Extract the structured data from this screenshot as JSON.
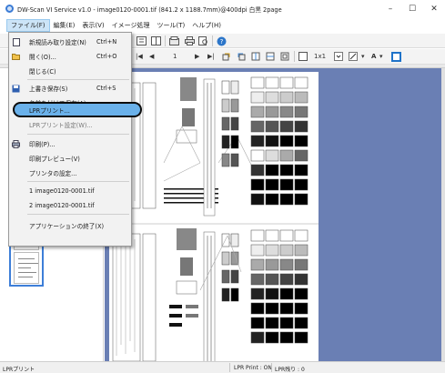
{
  "window": {
    "title": "DW-Scan VI Service v1.0 - image0120-0001.tif (841.2 x 1188.7mm)@400dpi 白黒 2page",
    "minimize": "–",
    "maximize": "☐",
    "close": "✕"
  },
  "menubar": {
    "items": [
      "ファイル(F)",
      "編集(E)",
      "表示(V)",
      "イメージ処理",
      "ツール(T)",
      "ヘルプ(H)"
    ]
  },
  "toolbar": {
    "page_number": "1",
    "zoom_label": "1x1",
    "font_label": "A"
  },
  "document_tab": {
    "label": "00dpi 白黒 2page",
    "close": "×"
  },
  "file_menu": {
    "items": [
      {
        "label": "新規読み取り設定(N)",
        "shortcut": "Ctrl+N",
        "icon": "page-icon"
      },
      {
        "label": "開く(O)...",
        "shortcut": "Ctrl+O",
        "icon": "folder-icon"
      },
      {
        "label": "閉じる(C)",
        "shortcut": "",
        "icon": ""
      },
      {
        "label": "上書き保存(S)",
        "shortcut": "Ctrl+S",
        "icon": "save-icon"
      },
      {
        "label": "名前を付けて保存(A)...",
        "shortcut": "",
        "icon": ""
      },
      {
        "label": "LPRプリント...",
        "shortcut": "",
        "icon": ""
      },
      {
        "label": "LPRプリント設定(W)...",
        "shortcut": "",
        "icon": ""
      },
      {
        "label": "印刷(P)...",
        "shortcut": "",
        "icon": "printer-icon"
      },
      {
        "label": "印刷プレビュー(V)",
        "shortcut": "",
        "icon": ""
      },
      {
        "label": "プリンタの設定...",
        "shortcut": "",
        "icon": ""
      },
      {
        "label": "1 image0120-0001.tif",
        "shortcut": "",
        "icon": ""
      },
      {
        "label": "2 image0120-0001.tif",
        "shortcut": "",
        "icon": ""
      },
      {
        "label": "アプリケーションの終了(X)",
        "shortcut": "",
        "icon": ""
      }
    ]
  },
  "statusbar": {
    "left": "LPRプリント",
    "lpr_print": "LPR Print : ON",
    "lpr_remaining": "LPR残り : 0"
  },
  "colors": {
    "main_background": "#6a7fb4",
    "highlight": "#6ab1ea",
    "thumbnail_border": "#3d7ed8"
  }
}
